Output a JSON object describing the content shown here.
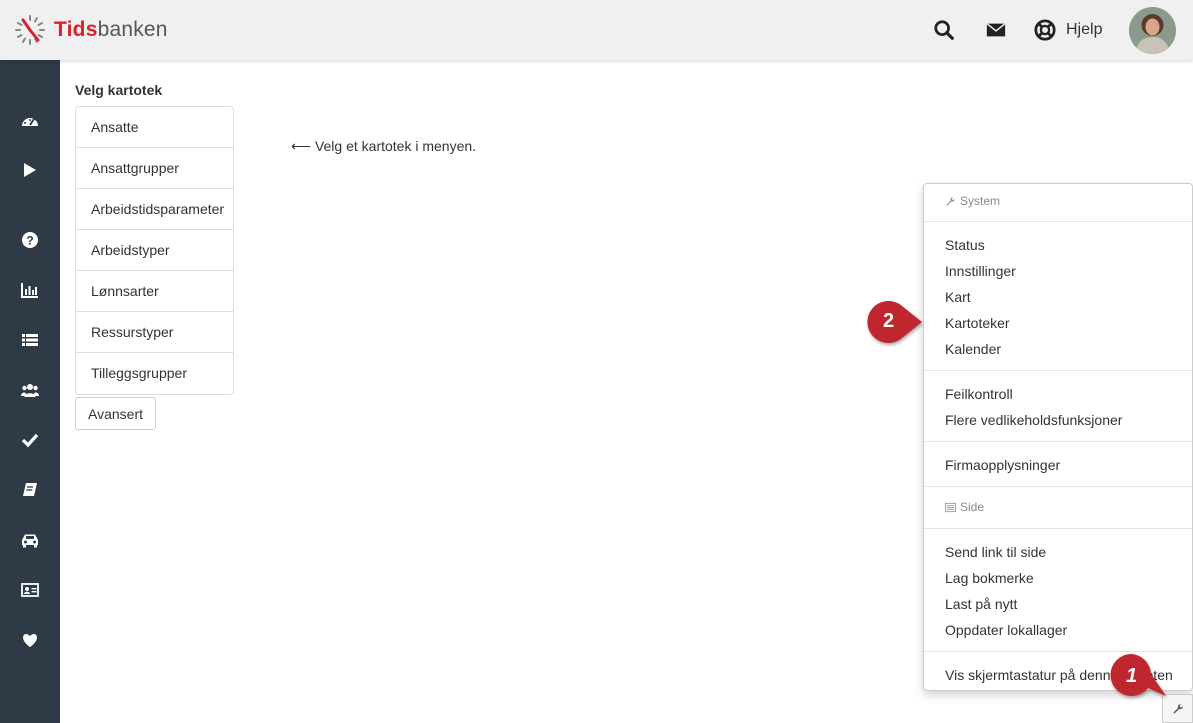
{
  "app": {
    "logo_tids": "Tids",
    "logo_banken": "banken",
    "help_label": "Hjelp"
  },
  "colors": {
    "header_bg": "#f0f0f0",
    "sidebar_bg": "#2e3a45",
    "brand_red": "#d9222a",
    "callout_red": "#c0282e"
  },
  "header_icons": [
    "search-icon",
    "envelope-icon",
    "lifebuoy-icon"
  ],
  "sidebar": {
    "items": [
      {
        "icon": "dashboard-icon"
      },
      {
        "icon": "play-icon"
      },
      {
        "icon": "question-icon"
      },
      {
        "icon": "bar-chart-icon"
      },
      {
        "icon": "list-icon"
      },
      {
        "icon": "users-icon"
      },
      {
        "icon": "check-icon"
      },
      {
        "icon": "book-icon"
      },
      {
        "icon": "car-icon"
      },
      {
        "icon": "id-card-icon"
      },
      {
        "icon": "heart-icon"
      }
    ]
  },
  "main": {
    "title": "Velg kartotek",
    "categories": [
      "Ansatte",
      "Ansattgrupper",
      "Arbeidstidsparameter",
      "Arbeidstyper",
      "Lønnsarter",
      "Ressurstyper",
      "Tilleggsgrupper"
    ],
    "advanced_button": "Avansert",
    "hint": "⟵ Velg et kartotek i menyen."
  },
  "menu": {
    "system_header": "System",
    "system_items": [
      "Status",
      "Innstillinger",
      "Kart",
      "Kartoteker",
      "Kalender"
    ],
    "maintenance_items": [
      "Feilkontroll",
      "Flere vedlikeholdsfunksjoner"
    ],
    "company_items": [
      "Firmaopplysninger"
    ],
    "side_header": "Side",
    "page_items": [
      "Send link til side",
      "Lag bokmerke",
      "Last på nytt",
      "Oppdater lokallager"
    ],
    "keyboard_item": "Vis skjermtastatur på denne enheten"
  },
  "callouts": {
    "first": "1",
    "second": "2"
  }
}
